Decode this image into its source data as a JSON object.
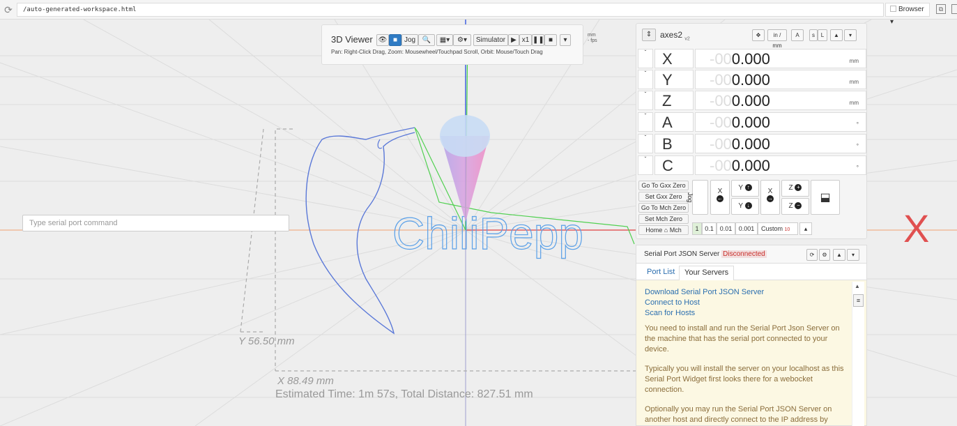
{
  "browser": {
    "url": "/auto-generated-workspace.html",
    "browser_label": "Browser"
  },
  "viewer": {
    "title": "3D Viewer",
    "jog_label": "Jog",
    "simulator_label": "Simulator",
    "speed_label": "x1",
    "help_text": "Pan: Right-Click Drag, Zoom: Mousewheel/Touchpad Scroll, Orbit: Mouse/Touch Drag",
    "units_label": "mm",
    "fps_label": "- fps",
    "y_dimension": "Y 56.50 mm",
    "x_dimension": "X 88.49 mm",
    "estimate": "Estimated Time: 1m 57s, Total Distance: 827.51 mm",
    "logo_text": "ChiliPepp",
    "x_axis_label": "X"
  },
  "serial_command": {
    "placeholder": "Type serial port command"
  },
  "axes": {
    "title": "axes2",
    "version": "v2",
    "units_toggle": "in / mm",
    "rows": [
      {
        "letter": "X",
        "dim": "-00",
        "value": "0.000",
        "unit": "mm"
      },
      {
        "letter": "Y",
        "dim": "-00",
        "value": "0.000",
        "unit": "mm"
      },
      {
        "letter": "Z",
        "dim": "-00",
        "value": "0.000",
        "unit": "mm"
      },
      {
        "letter": "A",
        "dim": "-00",
        "value": "0.000",
        "unit": "°"
      },
      {
        "letter": "B",
        "dim": "-00",
        "value": "0.000",
        "unit": "°"
      },
      {
        "letter": "C",
        "dim": "-00",
        "value": "0.000",
        "unit": "°"
      }
    ],
    "zero_buttons": [
      "Go To Gxx Zero",
      "Set Gxx Zero",
      "Go To Mch Zero",
      "Set Mch Zero",
      "Home",
      "Mch"
    ],
    "jog_label": "Jog",
    "jog": {
      "x": "X",
      "y": "Y",
      "z": "Z"
    },
    "steps": [
      "1",
      "0.1",
      "0.01",
      "0.001",
      "Custom"
    ],
    "custom_value": "10"
  },
  "serial_panel": {
    "title": "Serial Port JSON Server",
    "status": "Disconnected",
    "tabs": [
      "Port List",
      "Your Servers"
    ],
    "links": [
      "Download Serial Port JSON Server",
      "Connect to Host",
      "Scan for Hosts"
    ],
    "paragraphs": [
      "You need to install and run the Serial Port Json Server on the machine that has the serial port connected to your device.",
      "Typically you will install the server on your localhost as this Serial Port Widget first looks there for a webocket connection.",
      "Optionally you may run the Serial Port JSON Server on another host and directly connect to the IP address by"
    ]
  }
}
